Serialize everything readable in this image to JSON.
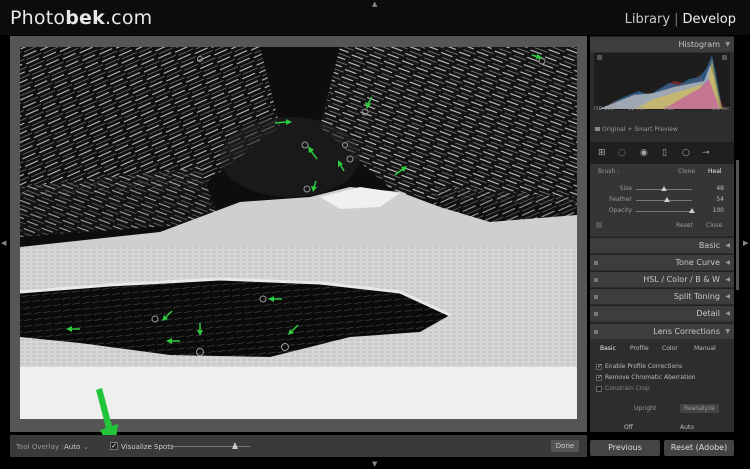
{
  "app": {
    "logo_prefix": "Photo",
    "logo_bold": "bek",
    "logo_suffix": ".com",
    "modules": [
      "Library",
      "Develop"
    ]
  },
  "panel": {
    "histogram": {
      "title": "Histogram",
      "info": [
        "ISO 100",
        "11 mm",
        "f/16",
        "1/3 sec"
      ],
      "original": "Original + Smart Preview"
    },
    "spot_removal": {
      "brush_label": "Brush :",
      "modes": [
        "Clone",
        "Heal"
      ],
      "active_mode": "Heal",
      "sliders": [
        {
          "name": "Size",
          "value": 48
        },
        {
          "name": "Feather",
          "value": 54
        },
        {
          "name": "Opacity",
          "value": 100
        }
      ],
      "reset": "Reset",
      "close": "Close"
    },
    "sections": [
      "Basic",
      "Tone Curve",
      "HSL / Color / B & W",
      "Split Toning",
      "Detail",
      "Lens Corrections"
    ],
    "lens": {
      "tabs": [
        "Basic",
        "Profile",
        "Color",
        "Manual"
      ],
      "active_tab": "Basic",
      "options": [
        {
          "label": "Enable Profile Corrections",
          "checked": true
        },
        {
          "label": "Remove Chromatic Aberration",
          "checked": true
        },
        {
          "label": "Constrain Crop",
          "checked": false
        }
      ],
      "upright": "Upright",
      "reanalyze": "Reanalyze",
      "upright_modes": [
        "Off",
        "Auto"
      ]
    }
  },
  "toolbar": {
    "tool_overlay_label": "Tool Overlay :",
    "tool_overlay_value": "Auto",
    "visualize_spots": "Visualize Spots",
    "visualize_checked": true,
    "done": "Done"
  },
  "footer": {
    "previous": "Previous",
    "reset": "Reset (Adobe)"
  },
  "colors": {
    "spot_arrows": "#2ecc40",
    "background": "#000000",
    "panel": "#2d2d2d"
  }
}
